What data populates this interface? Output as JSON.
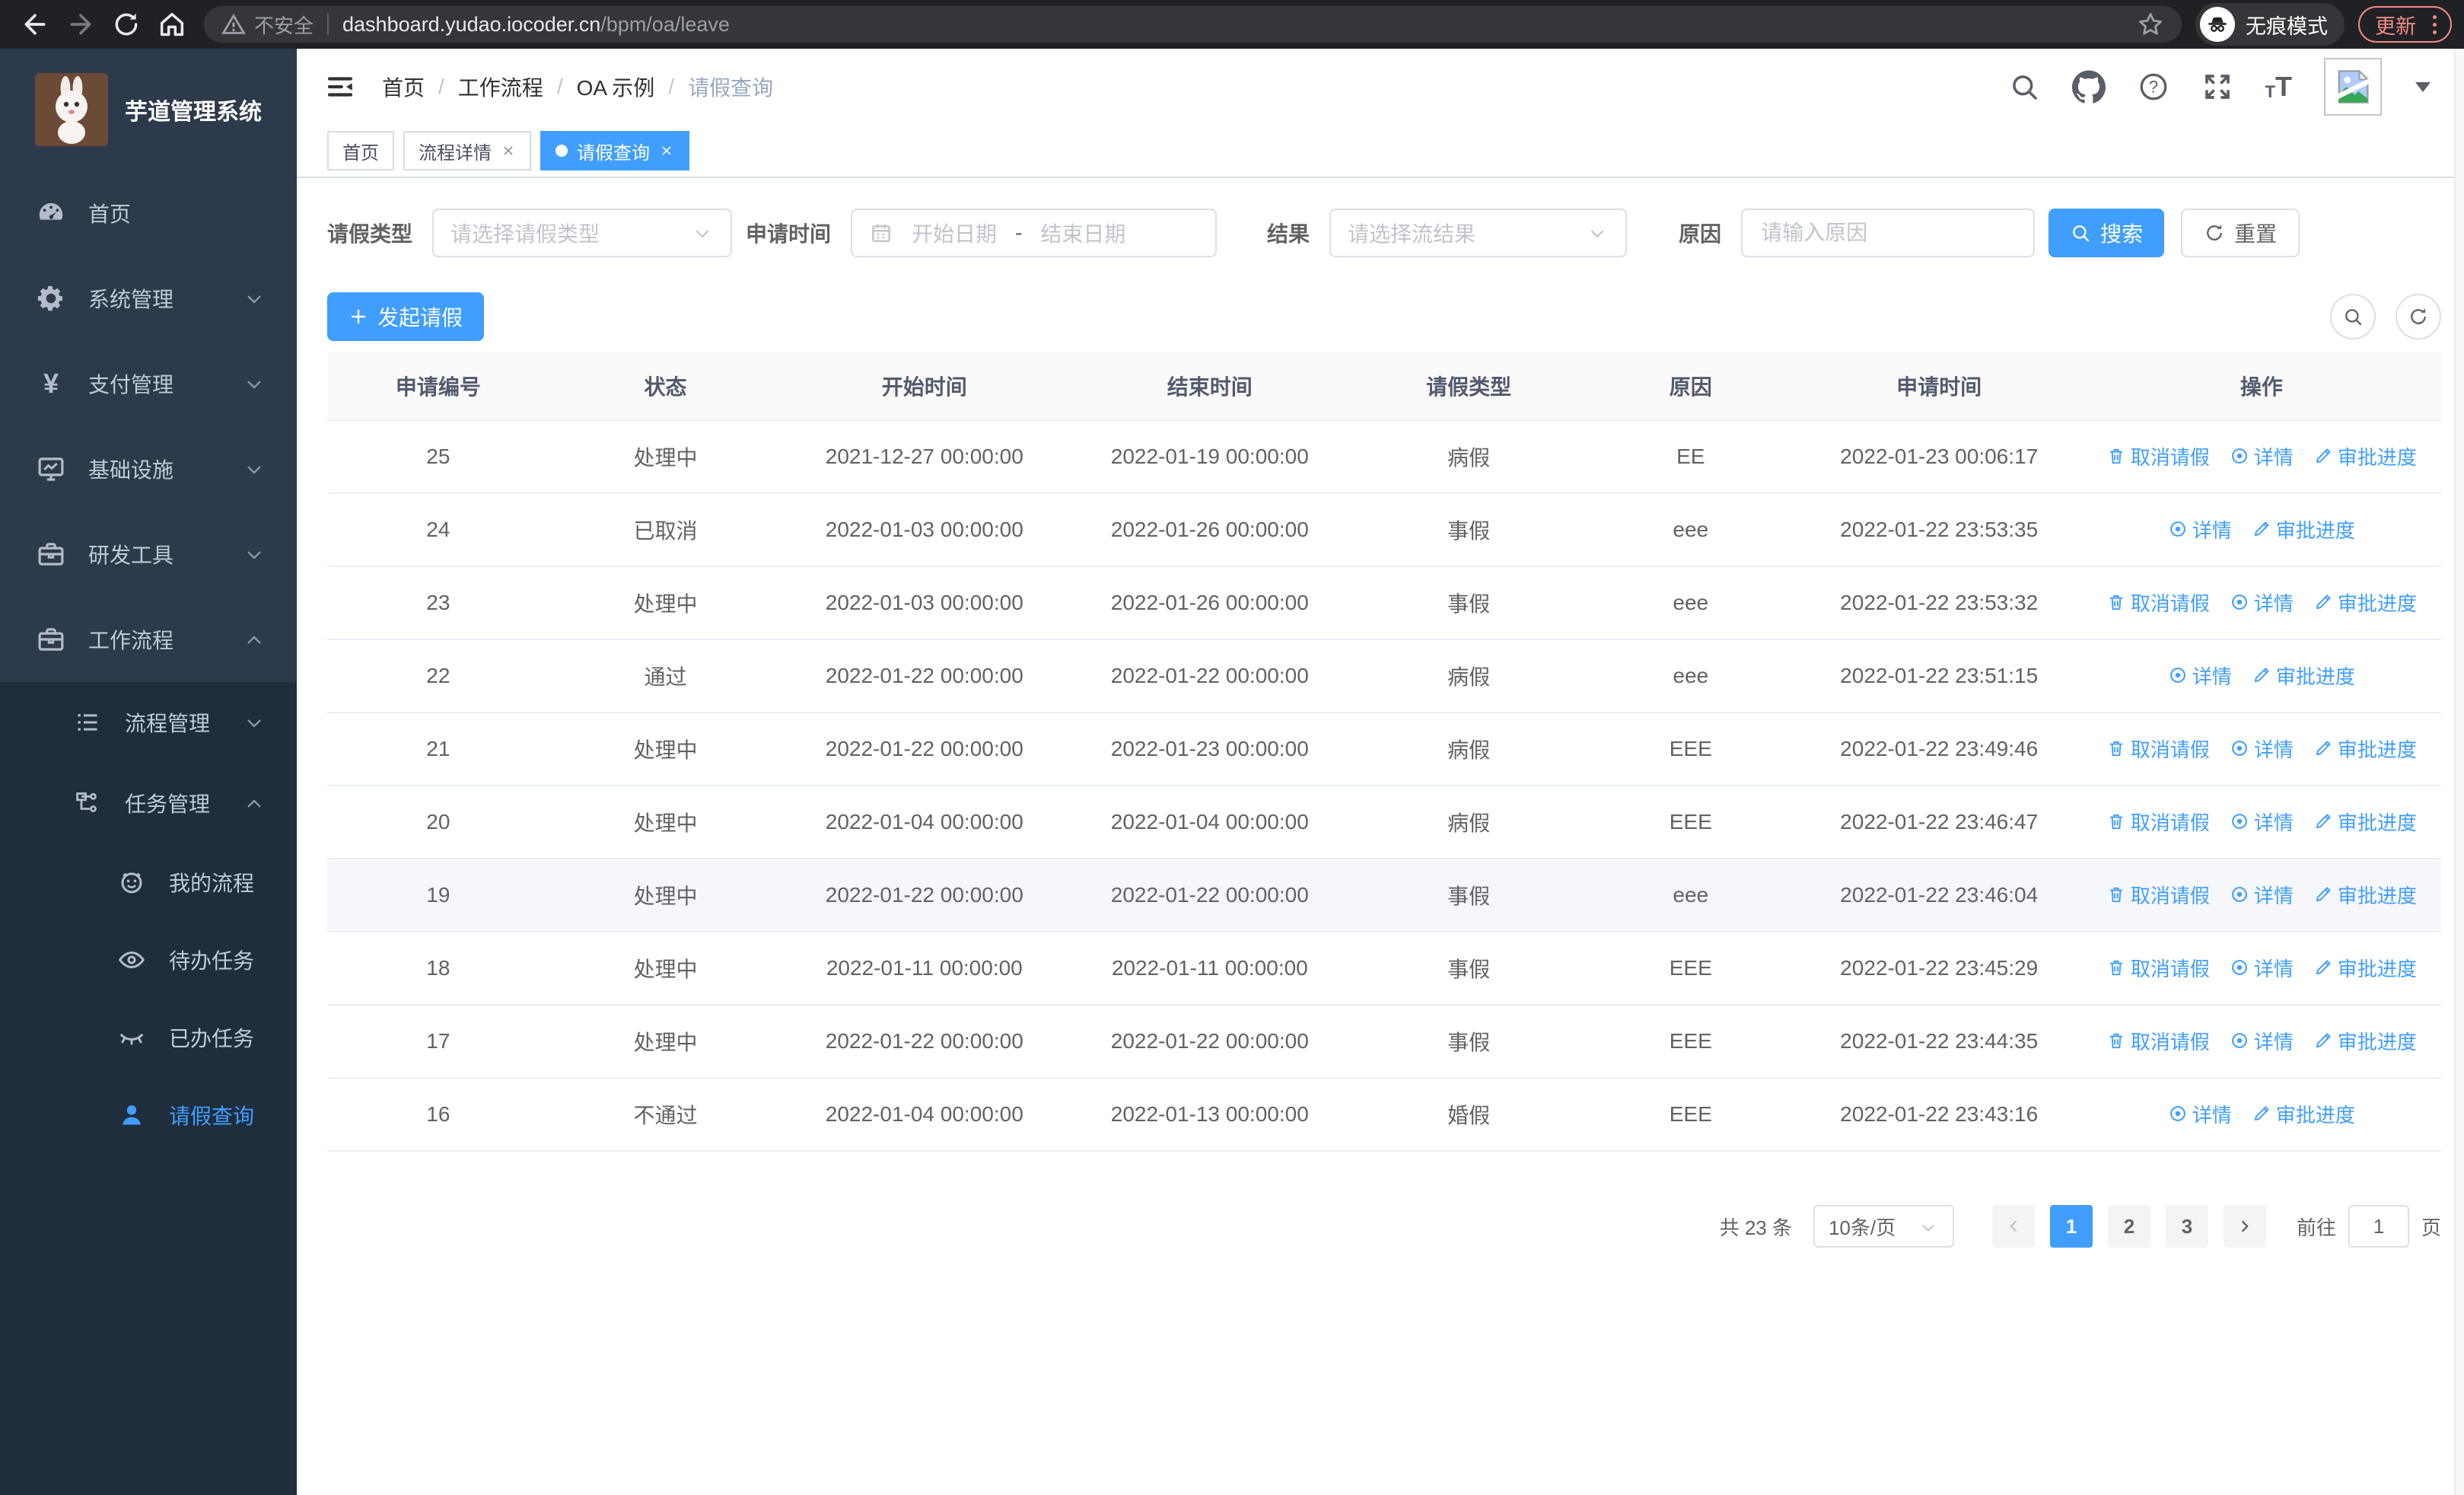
{
  "browser": {
    "security_label": "不安全",
    "url_host": "dashboard.yudao.iocoder.cn",
    "url_path": "/bpm/oa/leave",
    "incognito_label": "无痕模式",
    "update_label": "更新"
  },
  "sidebar": {
    "title": "芋道管理系统",
    "items": [
      {
        "label": "首页",
        "icon": "dashboard-icon",
        "level": 1
      },
      {
        "label": "系统管理",
        "icon": "gear-icon",
        "level": 1,
        "arrow": "down"
      },
      {
        "label": "支付管理",
        "icon": "yen-icon",
        "level": 1,
        "arrow": "down"
      },
      {
        "label": "基础设施",
        "icon": "monitor-icon",
        "level": 1,
        "arrow": "down"
      },
      {
        "label": "研发工具",
        "icon": "toolbox-icon",
        "level": 1,
        "arrow": "down"
      },
      {
        "label": "工作流程",
        "icon": "briefcase-icon",
        "level": 1,
        "arrow": "up"
      },
      {
        "label": "流程管理",
        "icon": "list-icon",
        "level": 2,
        "arrow": "down"
      },
      {
        "label": "任务管理",
        "icon": "share-icon",
        "level": 2,
        "arrow": "up"
      },
      {
        "label": "我的流程",
        "icon": "face-icon",
        "level": 3
      },
      {
        "label": "待办任务",
        "icon": "eye-open-icon",
        "level": 3
      },
      {
        "label": "已办任务",
        "icon": "eye-closed-icon",
        "level": 3
      },
      {
        "label": "请假查询",
        "icon": "user-icon",
        "level": 3,
        "active": true
      }
    ]
  },
  "navbar": {
    "breadcrumb": [
      "首页",
      "工作流程",
      "OA 示例",
      "请假查询"
    ],
    "font_icon_small": "T",
    "font_icon_big": "T",
    "yen_glyph": "¥"
  },
  "tabs": [
    {
      "label": "首页",
      "closable": false,
      "active": false
    },
    {
      "label": "流程详情",
      "closable": true,
      "active": false
    },
    {
      "label": "请假查询",
      "closable": true,
      "active": true
    }
  ],
  "filters": {
    "leave_type_label": "请假类型",
    "leave_type_placeholder": "请选择请假类型",
    "apply_time_label": "申请时间",
    "start_date_placeholder": "开始日期",
    "range_separator": "-",
    "end_date_placeholder": "结束日期",
    "result_label": "结果",
    "result_placeholder": "请选择流结果",
    "reason_label": "原因",
    "reason_placeholder": "请输入原因",
    "search_button": "搜索",
    "reset_button": "重置"
  },
  "toolbar": {
    "create_button": "发起请假"
  },
  "table": {
    "columns": [
      "申请编号",
      "状态",
      "开始时间",
      "结束时间",
      "请假类型",
      "原因",
      "申请时间",
      "操作"
    ],
    "actions": {
      "cancel": "取消请假",
      "detail": "详情",
      "progress": "审批进度"
    },
    "rows": [
      {
        "id": "25",
        "status": "处理中",
        "start": "2021-12-27 00:00:00",
        "end": "2022-01-19 00:00:00",
        "type": "病假",
        "reason": "EE",
        "applied": "2022-01-23 00:06:17",
        "actions": [
          "cancel",
          "detail",
          "progress"
        ]
      },
      {
        "id": "24",
        "status": "已取消",
        "start": "2022-01-03 00:00:00",
        "end": "2022-01-26 00:00:00",
        "type": "事假",
        "reason": "eee",
        "applied": "2022-01-22 23:53:35",
        "actions": [
          "detail",
          "progress"
        ]
      },
      {
        "id": "23",
        "status": "处理中",
        "start": "2022-01-03 00:00:00",
        "end": "2022-01-26 00:00:00",
        "type": "事假",
        "reason": "eee",
        "applied": "2022-01-22 23:53:32",
        "actions": [
          "cancel",
          "detail",
          "progress"
        ]
      },
      {
        "id": "22",
        "status": "通过",
        "start": "2022-01-22 00:00:00",
        "end": "2022-01-22 00:00:00",
        "type": "病假",
        "reason": "eee",
        "applied": "2022-01-22 23:51:15",
        "actions": [
          "detail",
          "progress"
        ]
      },
      {
        "id": "21",
        "status": "处理中",
        "start": "2022-01-22 00:00:00",
        "end": "2022-01-23 00:00:00",
        "type": "病假",
        "reason": "EEE",
        "applied": "2022-01-22 23:49:46",
        "actions": [
          "cancel",
          "detail",
          "progress"
        ]
      },
      {
        "id": "20",
        "status": "处理中",
        "start": "2022-01-04 00:00:00",
        "end": "2022-01-04 00:00:00",
        "type": "病假",
        "reason": "EEE",
        "applied": "2022-01-22 23:46:47",
        "actions": [
          "cancel",
          "detail",
          "progress"
        ]
      },
      {
        "id": "19",
        "status": "处理中",
        "start": "2022-01-22 00:00:00",
        "end": "2022-01-22 00:00:00",
        "type": "事假",
        "reason": "eee",
        "applied": "2022-01-22 23:46:04",
        "actions": [
          "cancel",
          "detail",
          "progress"
        ]
      },
      {
        "id": "18",
        "status": "处理中",
        "start": "2022-01-11 00:00:00",
        "end": "2022-01-11 00:00:00",
        "type": "事假",
        "reason": "EEE",
        "applied": "2022-01-22 23:45:29",
        "actions": [
          "cancel",
          "detail",
          "progress"
        ]
      },
      {
        "id": "17",
        "status": "处理中",
        "start": "2022-01-22 00:00:00",
        "end": "2022-01-22 00:00:00",
        "type": "事假",
        "reason": "EEE",
        "applied": "2022-01-22 23:44:35",
        "actions": [
          "cancel",
          "detail",
          "progress"
        ]
      },
      {
        "id": "16",
        "status": "不通过",
        "start": "2022-01-04 00:00:00",
        "end": "2022-01-13 00:00:00",
        "type": "婚假",
        "reason": "EEE",
        "applied": "2022-01-22 23:43:16",
        "actions": [
          "detail",
          "progress"
        ]
      }
    ]
  },
  "pagination": {
    "total_label": "共 23 条",
    "page_size_label": "10条/页",
    "pages": [
      "1",
      "2",
      "3"
    ],
    "current_page": "1",
    "goto_label": "前往",
    "goto_value": "1",
    "unit_label": "页"
  },
  "colors": {
    "primary": "#409eff",
    "sidebar_bg": "#2d3a4b",
    "sidebar_submenu_bg": "#1f2d3d",
    "sidebar_text": "#bfcbd9",
    "table_border": "#ebeef5",
    "update_accent": "#f28b82"
  }
}
